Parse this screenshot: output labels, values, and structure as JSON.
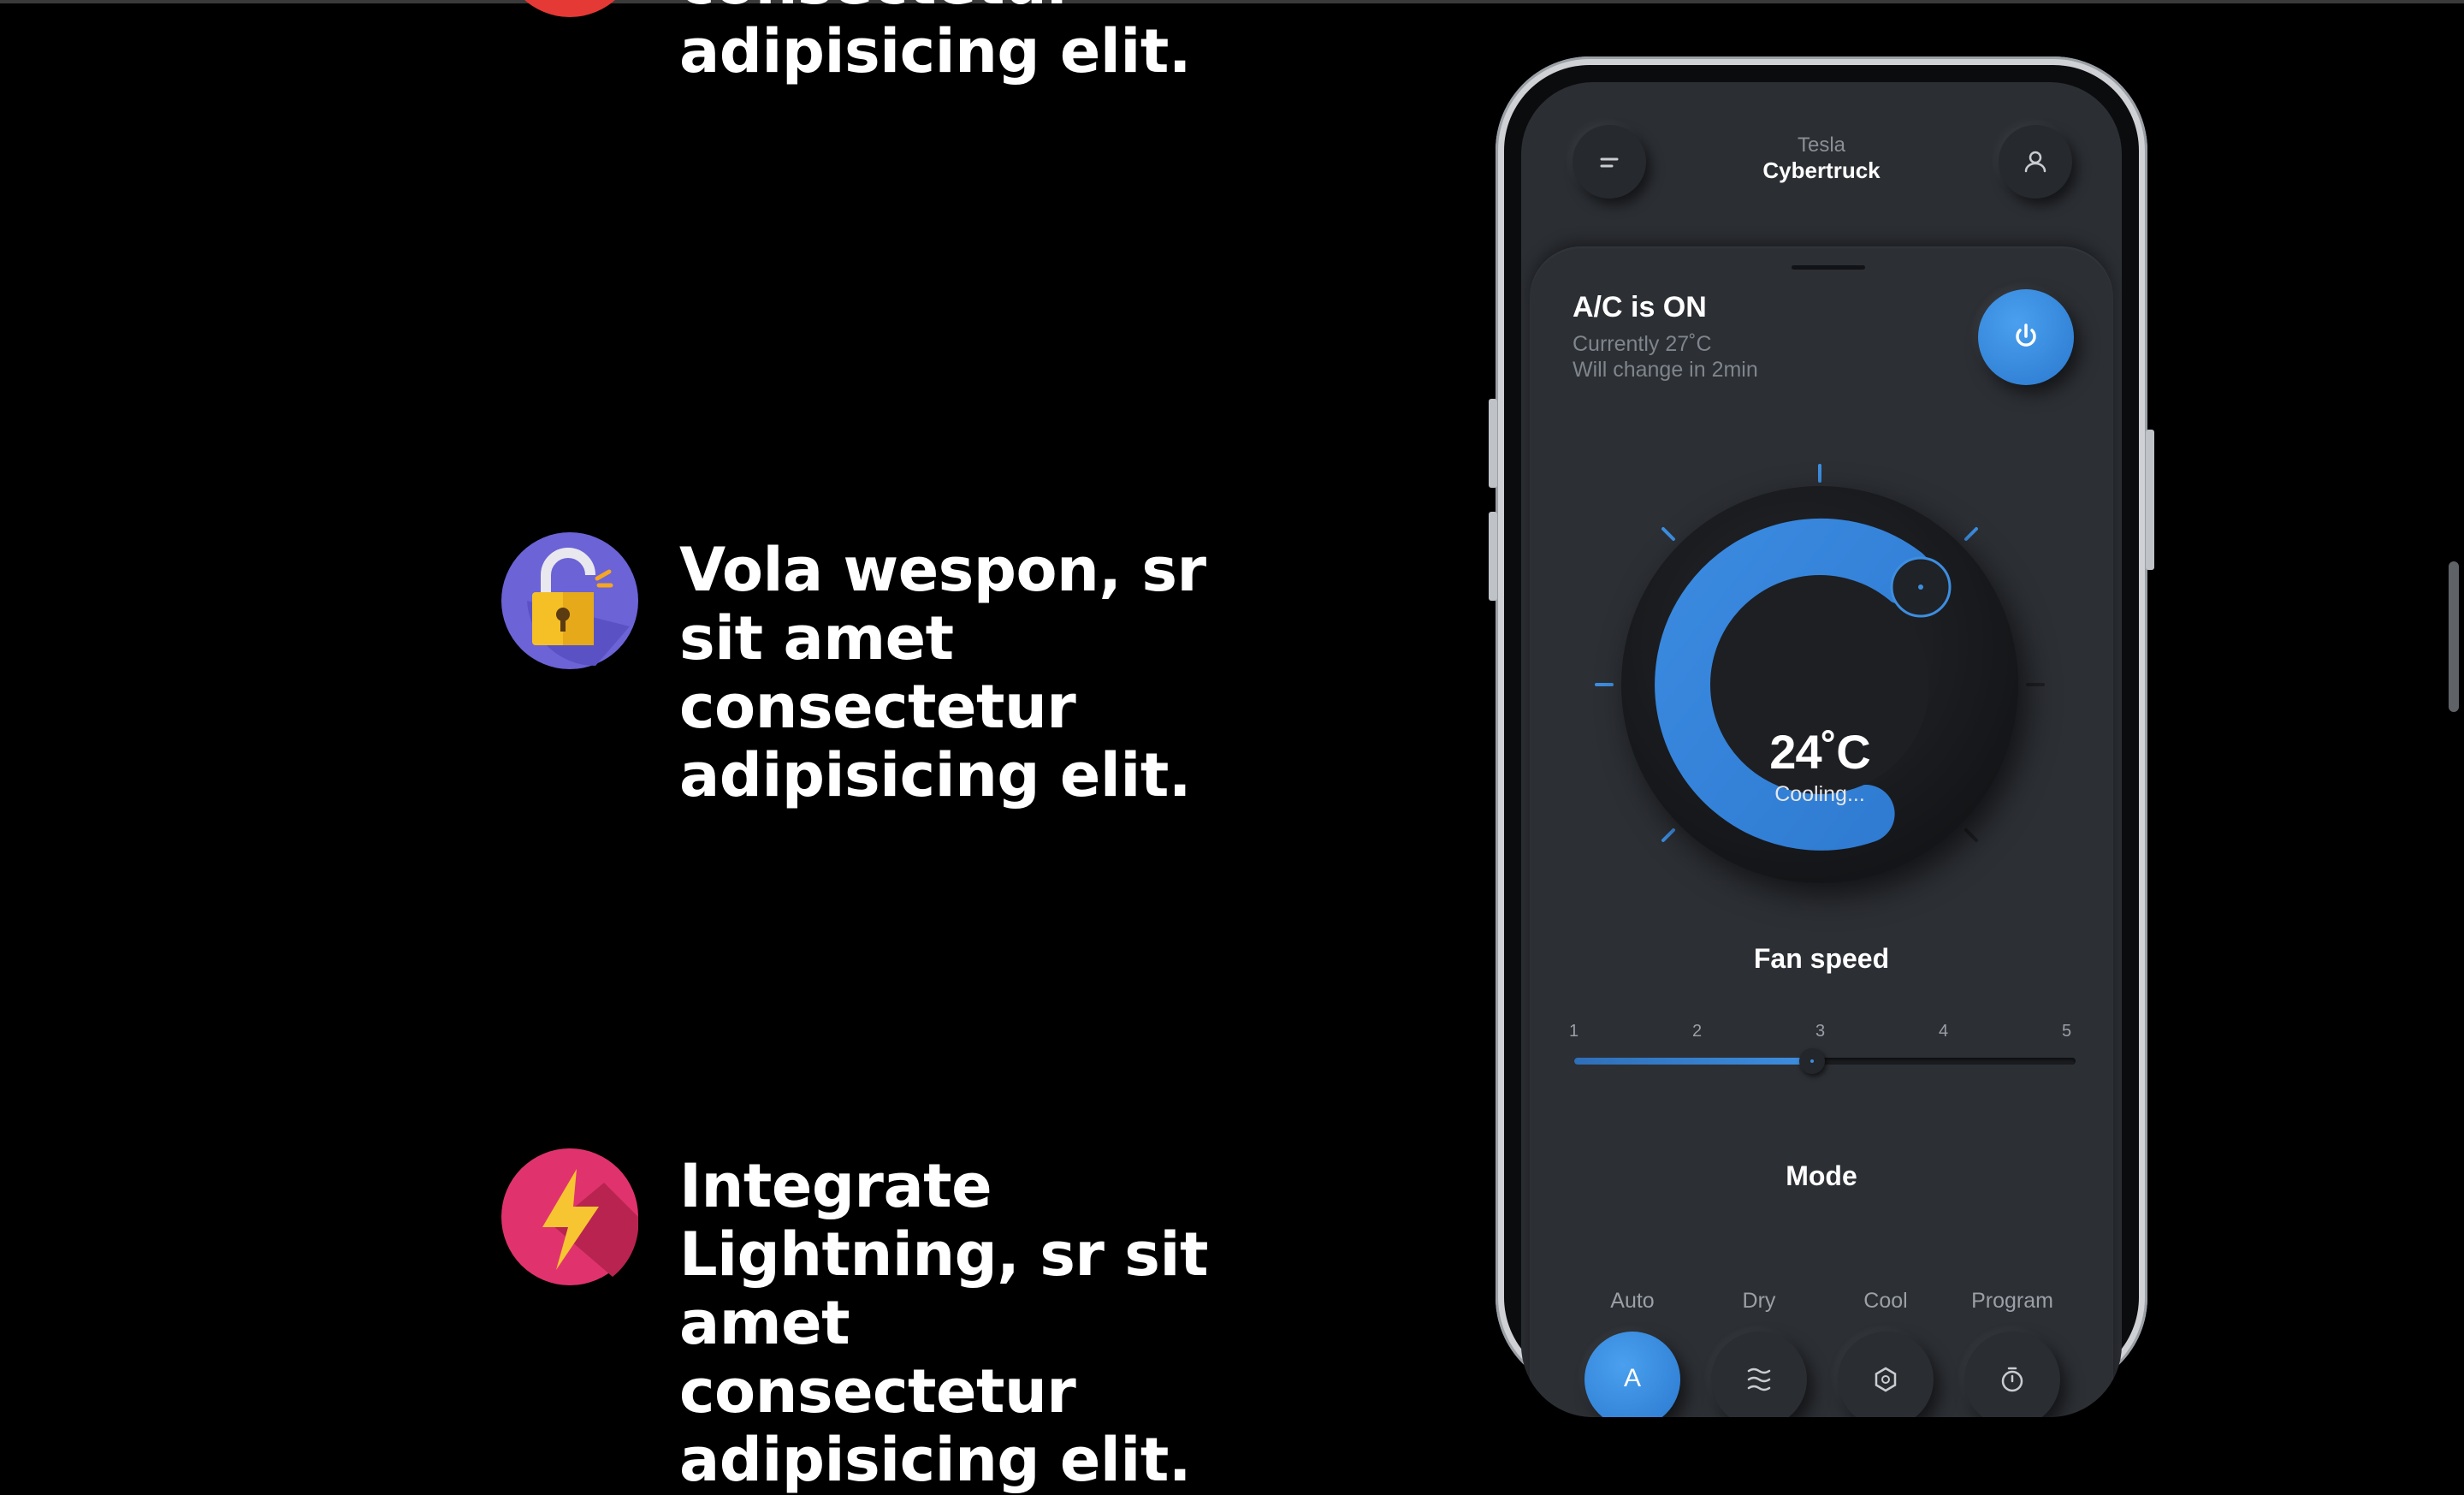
{
  "features": [
    {
      "id": "f1",
      "icon": "target-icon",
      "text": "sr sit amet consectetur adipisicing elit."
    },
    {
      "id": "f2",
      "icon": "unlock-icon",
      "text": "Vola wespon, sr sit amet consectetur adipisicing elit."
    },
    {
      "id": "f3",
      "icon": "lightning-icon",
      "text": "Integrate Lightning, sr sit amet consectetur adipisicing elit."
    }
  ],
  "phone": {
    "header": {
      "brand": "Tesla",
      "model": "Cybertruck",
      "menu_icon": "menu-icon",
      "profile_icon": "user-icon"
    },
    "ac": {
      "title": "A/C is ON",
      "current": "Currently 27˚C",
      "change": "Will change in 2min",
      "power_icon": "power-icon"
    },
    "dial": {
      "temperature": "24˚C",
      "status": "Cooling..."
    },
    "fan": {
      "title": "Fan speed",
      "scale": [
        "1",
        "2",
        "3",
        "4",
        "5"
      ],
      "value": 2.9
    },
    "mode": {
      "title": "Mode",
      "options": [
        {
          "label": "Auto",
          "icon": "auto-icon",
          "glyph": "A",
          "active": true
        },
        {
          "label": "Dry",
          "icon": "dry-icon",
          "active": false
        },
        {
          "label": "Cool",
          "icon": "cool-icon",
          "active": false
        },
        {
          "label": "Program",
          "icon": "timer-icon",
          "active": false
        }
      ]
    }
  },
  "colors": {
    "accent": "#3d8ee0",
    "background": "#000000",
    "surface": "#2c2f34"
  }
}
